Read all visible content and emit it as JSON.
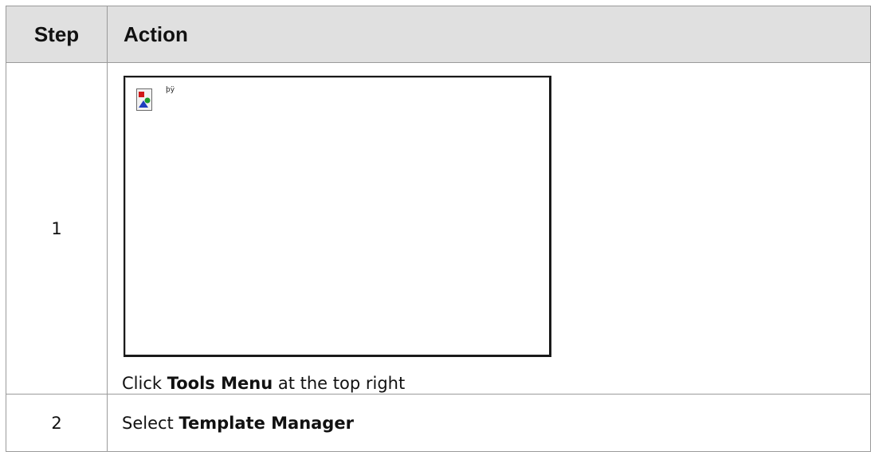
{
  "table": {
    "header": {
      "step": "Step",
      "action": "Action"
    },
    "rows": [
      {
        "step": "1",
        "image_alt": "þÿ",
        "image_icon": "broken-image-icon",
        "text_before": "Click ",
        "text_bold": "Tools Menu",
        "text_after": " at the top right"
      },
      {
        "step": "2",
        "text_before": "Select ",
        "text_bold": "Template Manager",
        "text_after": ""
      }
    ]
  }
}
